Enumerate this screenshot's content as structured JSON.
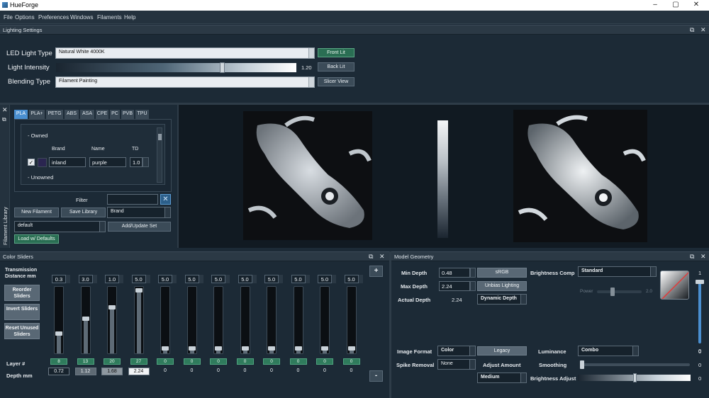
{
  "app": {
    "title": "HueForge"
  },
  "menu": [
    "File",
    "Options",
    "Preferences",
    "Windows",
    "Filaments",
    "Help"
  ],
  "lighting": {
    "panel_title": "Lighting Settings",
    "led_label": "LED Light Type",
    "led_value": "Natural White 4000K",
    "intensity_label": "Light Intensity",
    "intensity_value": "1.20",
    "intensity_fraction": 0.69,
    "blending_label": "Blending Type",
    "blending_value": "Filament Painting",
    "front_lit": "Front Lit",
    "back_lit": "Back Lit",
    "slicer_view": "Slicer View"
  },
  "library": {
    "vertical_title": "Filament Library",
    "tabs": [
      "PLA",
      "PLA+",
      "PETG",
      "ABS",
      "ASA",
      "CPE",
      "PC",
      "PVB",
      "TPU"
    ],
    "active_tab": "PLA",
    "owned_label": "- Owned",
    "unowned_label": "- Unowned",
    "columns": {
      "brand": "Brand",
      "name": "Name",
      "td": "TD"
    },
    "row": {
      "brand": "inland",
      "name": "purple",
      "td": "1.0",
      "color": "#2a2550"
    },
    "filter_label": "Filter",
    "filter_value": "",
    "new_filament": "New Filament",
    "save_library": "Save Library",
    "sort_value": "Brand",
    "set_value": "default",
    "add_update_set": "Add/Update Set",
    "load_defaults": "Load w/ Defaults"
  },
  "color_sliders": {
    "panel_title": "Color Sliders",
    "transmission_label": "Transmission Distance mm",
    "reorder": "Reorder Sliders",
    "invert": "Invert Sliders",
    "reset": "Reset Unused Sliders",
    "layer_label": "Layer #",
    "depth_label": "Depth mm",
    "plus": "+",
    "minus": "-",
    "sliders": [
      {
        "td": "0.3",
        "layer": "8",
        "depth": "0.72",
        "pos": 0.72,
        "swatch": "#16222c"
      },
      {
        "td": "3.0",
        "layer": "13",
        "depth": "1.12",
        "pos": 0.48,
        "swatch": "#5e6a74"
      },
      {
        "td": "1.0",
        "layer": "20",
        "depth": "1.68",
        "pos": 0.3,
        "swatch": "#8e98a0"
      },
      {
        "td": "5.0",
        "layer": "27",
        "depth": "2.24",
        "pos": 0.02,
        "swatch": "#f2f4f6"
      },
      {
        "td": "5.0",
        "layer": "0",
        "depth": "0",
        "pos": 0.95,
        "swatch": ""
      },
      {
        "td": "5.0",
        "layer": "0",
        "depth": "0",
        "pos": 0.95,
        "swatch": ""
      },
      {
        "td": "5.0",
        "layer": "0",
        "depth": "0",
        "pos": 0.95,
        "swatch": ""
      },
      {
        "td": "5.0",
        "layer": "0",
        "depth": "0",
        "pos": 0.95,
        "swatch": ""
      },
      {
        "td": "5.0",
        "layer": "0",
        "depth": "0",
        "pos": 0.95,
        "swatch": ""
      },
      {
        "td": "5.0",
        "layer": "0",
        "depth": "0",
        "pos": 0.95,
        "swatch": ""
      },
      {
        "td": "5.0",
        "layer": "0",
        "depth": "0",
        "pos": 0.95,
        "swatch": ""
      },
      {
        "td": "5.0",
        "layer": "0",
        "depth": "0",
        "pos": 0.95,
        "swatch": ""
      }
    ]
  },
  "geometry": {
    "panel_title": "Model Geometry",
    "min_depth_label": "Min Depth",
    "min_depth": "0.48",
    "max_depth_label": "Max Depth",
    "max_depth": "2.24",
    "actual_depth_label": "Actual Depth",
    "actual_depth": "2.24",
    "srgb": "sRGB",
    "unbias": "Unbias Lighting",
    "dynamic_depth": "Dynamic Depth",
    "brightness_comp_label": "Brightness Comp",
    "brightness_comp": "Standard",
    "power_label": "Power",
    "power_value": "2.0",
    "power_fraction": 0.35,
    "vert_top": "1",
    "vert_bottom": "0",
    "vert_fraction": 1.0,
    "image_format_label": "Image Format",
    "image_format": "Color",
    "legacy": "Legacy",
    "luminance_label": "Luminance",
    "luminance": "Combo",
    "spike_label": "Spike Removal",
    "spike": "None",
    "adjust_amount_label": "Adjust Amount",
    "adjust_amount": "Medium",
    "smoothing_label": "Smoothing",
    "smoothing_value": "0",
    "smoothing_fraction": 0.0,
    "brightness_adjust_label": "Brightness Adjust",
    "brightness_adjust_value": "0",
    "brightness_adjust_fraction": 0.5
  },
  "colors": {
    "accent": "#2a6e53",
    "tab_active": "#4a8fd0",
    "panel_bg": "#1c2a36"
  }
}
